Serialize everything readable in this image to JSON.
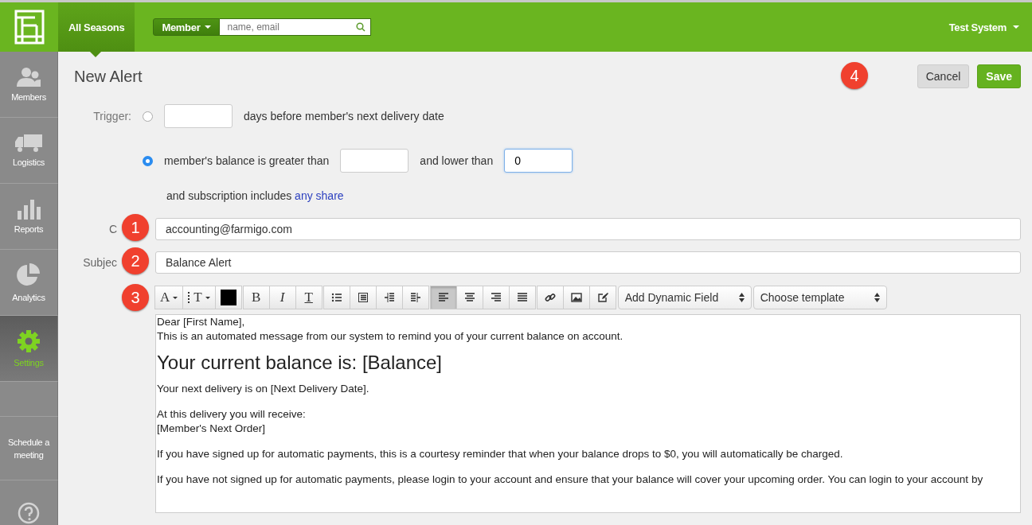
{
  "topbar": {
    "season": "All Seasons",
    "search_scope": "Member",
    "search": {
      "placeholder": "name, email"
    },
    "user": "Test System"
  },
  "sidebar": {
    "items": [
      {
        "kind": "members",
        "label": "Members",
        "selected": false
      },
      {
        "kind": "logistics",
        "label": "Logistics",
        "selected": false
      },
      {
        "kind": "reports",
        "label": "Reports",
        "selected": false
      },
      {
        "kind": "analytics",
        "label": "Analytics",
        "selected": false
      },
      {
        "kind": "settings",
        "label": "Settings",
        "selected": true
      },
      {
        "kind": "blank",
        "selected": false
      },
      {
        "kind": "meeting",
        "label": "Schedule a meeting",
        "selected": false
      },
      {
        "kind": "help",
        "selected": false
      }
    ]
  },
  "title": "New Alert",
  "buttons": [
    {
      "kind": "cancel",
      "label": "Cancel"
    },
    {
      "kind": "save",
      "label": "Save"
    }
  ],
  "badges": [
    "1",
    "2",
    "3",
    "4"
  ],
  "trigger": {
    "label": "Trigger:",
    "options": [
      {
        "selected": false,
        "after": "days before member's next delivery date"
      },
      {
        "selected": true,
        "before": "member's balance is greater than",
        "between": "and lower than",
        "value": "0"
      }
    ],
    "subscription": {
      "text": "and subscription includes",
      "link": "any share"
    }
  },
  "cc": {
    "label": "C",
    "value": "accounting@farmigo.com"
  },
  "subject": {
    "label": "Subjec",
    "value": "Balance Alert"
  },
  "toolbar": [
    {
      "kind": "font",
      "label": "A",
      "selected": false
    },
    {
      "kind": "size",
      "label": "T",
      "selected": false
    },
    {
      "kind": "color",
      "selected": false
    },
    {
      "kind": "bold",
      "label": "B",
      "selected": false
    },
    {
      "kind": "italic",
      "label": "I",
      "selected": false
    },
    {
      "kind": "strike",
      "label": "T",
      "selected": false
    },
    {
      "kind": "ul",
      "selected": false
    },
    {
      "kind": "ol",
      "selected": false
    },
    {
      "kind": "outdent",
      "selected": false
    },
    {
      "kind": "indent",
      "selected": false
    },
    {
      "kind": "left",
      "selected": true
    },
    {
      "kind": "center",
      "selected": false
    },
    {
      "kind": "right",
      "selected": false
    },
    {
      "kind": "justify",
      "selected": false
    },
    {
      "kind": "link",
      "selected": false
    },
    {
      "kind": "image",
      "selected": false
    },
    {
      "kind": "edit",
      "selected": false
    }
  ],
  "selects": [
    "Add Dynamic Field",
    "Choose template"
  ],
  "body": [
    {
      "kind": "p",
      "text": "Dear [First Name],"
    },
    {
      "kind": "p",
      "text": "This is an automated message from our system to remind you of your current balance on account."
    },
    {
      "kind": "h",
      "text": "Your current balance is: [Balance]"
    },
    {
      "kind": "p",
      "text": "Your next delivery is on [Next Delivery Date]."
    },
    {
      "kind": "gap"
    },
    {
      "kind": "p",
      "text": "At this delivery you will receive:"
    },
    {
      "kind": "p",
      "text": "[Member's Next Order]"
    },
    {
      "kind": "gap"
    },
    {
      "kind": "p",
      "text": "If you have signed up for automatic payments, this is a courtesy reminder that when your balance drops to $0, you will automatically be charged."
    },
    {
      "kind": "gap"
    },
    {
      "kind": "p",
      "text": "If you have not signed up for automatic payments, please login to your account and ensure that your balance will cover your upcoming order. You can login to your account by"
    }
  ]
}
